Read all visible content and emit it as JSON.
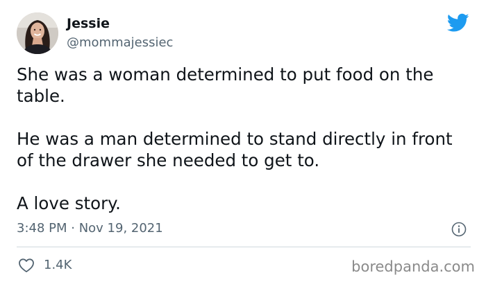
{
  "author": {
    "display_name": "Jessie",
    "handle": "@mommajessiec",
    "avatar_icon": "user-photo"
  },
  "brand": {
    "icon": "twitter-bird-icon",
    "color": "#1d9bf0"
  },
  "tweet": {
    "paragraphs": [
      "She was a woman determined to put food on the table.",
      "He was a man determined to stand directly in front of the drawer she needed to get to.",
      "A love story."
    ],
    "timestamp": "3:48 PM · Nov 19, 2021"
  },
  "actions": {
    "like_icon": "heart-outline-icon",
    "like_count": "1.4K",
    "info_icon": "info-circle-icon"
  },
  "watermark": "boredpanda.com",
  "colors": {
    "text_primary": "#0f1419",
    "text_secondary": "#536471",
    "divider": "#cfd9de"
  }
}
